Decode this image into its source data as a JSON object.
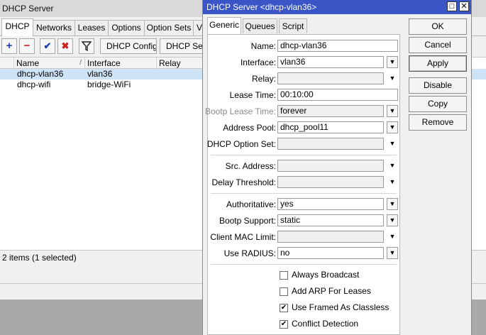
{
  "bg_window": {
    "title": "DHCP Server",
    "tabs": [
      "DHCP",
      "Networks",
      "Leases",
      "Options",
      "Option Sets",
      "V"
    ],
    "toolbar": {
      "add_icon": "plus-icon",
      "remove_icon": "minus-icon",
      "enable_icon": "check-icon",
      "disable_icon": "x-icon",
      "filter_icon": "filter-icon",
      "dhcp_config": "DHCP Config",
      "dhcp_setup": "DHCP Setu"
    },
    "columns": [
      "Name",
      "Interface",
      "Relay"
    ],
    "sort_indicator": "/",
    "rows": [
      {
        "name": "dhcp-vlan36",
        "interface": "vlan36",
        "relay": "",
        "selected": true
      },
      {
        "name": "dhcp-wifi",
        "interface": "bridge-WiFi",
        "relay": "",
        "selected": false
      }
    ],
    "status": "2 items (1 selected)"
  },
  "dialog": {
    "title": "DHCP Server <dhcp-vlan36>",
    "tabs": [
      "Generic",
      "Queues",
      "Script"
    ],
    "fields": {
      "name": {
        "label": "Name:",
        "value": "dhcp-vlan36"
      },
      "interface": {
        "label": "Interface:",
        "value": "vlan36"
      },
      "relay": {
        "label": "Relay:",
        "value": ""
      },
      "lease_time": {
        "label": "Lease Time:",
        "value": "00:10:00"
      },
      "bootp_lease_time": {
        "label": "Bootp Lease Time:",
        "value": "forever"
      },
      "address_pool": {
        "label": "Address Pool:",
        "value": "dhcp_pool11"
      },
      "dhcp_option_set": {
        "label": "DHCP Option Set:",
        "value": ""
      },
      "src_address": {
        "label": "Src. Address:",
        "value": ""
      },
      "delay_threshold": {
        "label": "Delay Threshold:",
        "value": ""
      },
      "authoritative": {
        "label": "Authoritative:",
        "value": "yes"
      },
      "bootp_support": {
        "label": "Bootp Support:",
        "value": "static"
      },
      "client_mac_limit": {
        "label": "Client MAC Limit:",
        "value": ""
      },
      "use_radius": {
        "label": "Use RADIUS:",
        "value": "no"
      }
    },
    "checkboxes": [
      {
        "label": "Always Broadcast",
        "checked": false
      },
      {
        "label": "Add ARP For Leases",
        "checked": false
      },
      {
        "label": "Use Framed As Classless",
        "checked": true
      },
      {
        "label": "Conflict Detection",
        "checked": true
      }
    ],
    "buttons": {
      "ok": "OK",
      "cancel": "Cancel",
      "apply": "Apply",
      "disable": "Disable",
      "copy": "Copy",
      "remove": "Remove"
    },
    "check_glyph": "✔",
    "dropdown_glyph": "▼",
    "restore_glyph": "□",
    "close_glyph": "✕"
  }
}
